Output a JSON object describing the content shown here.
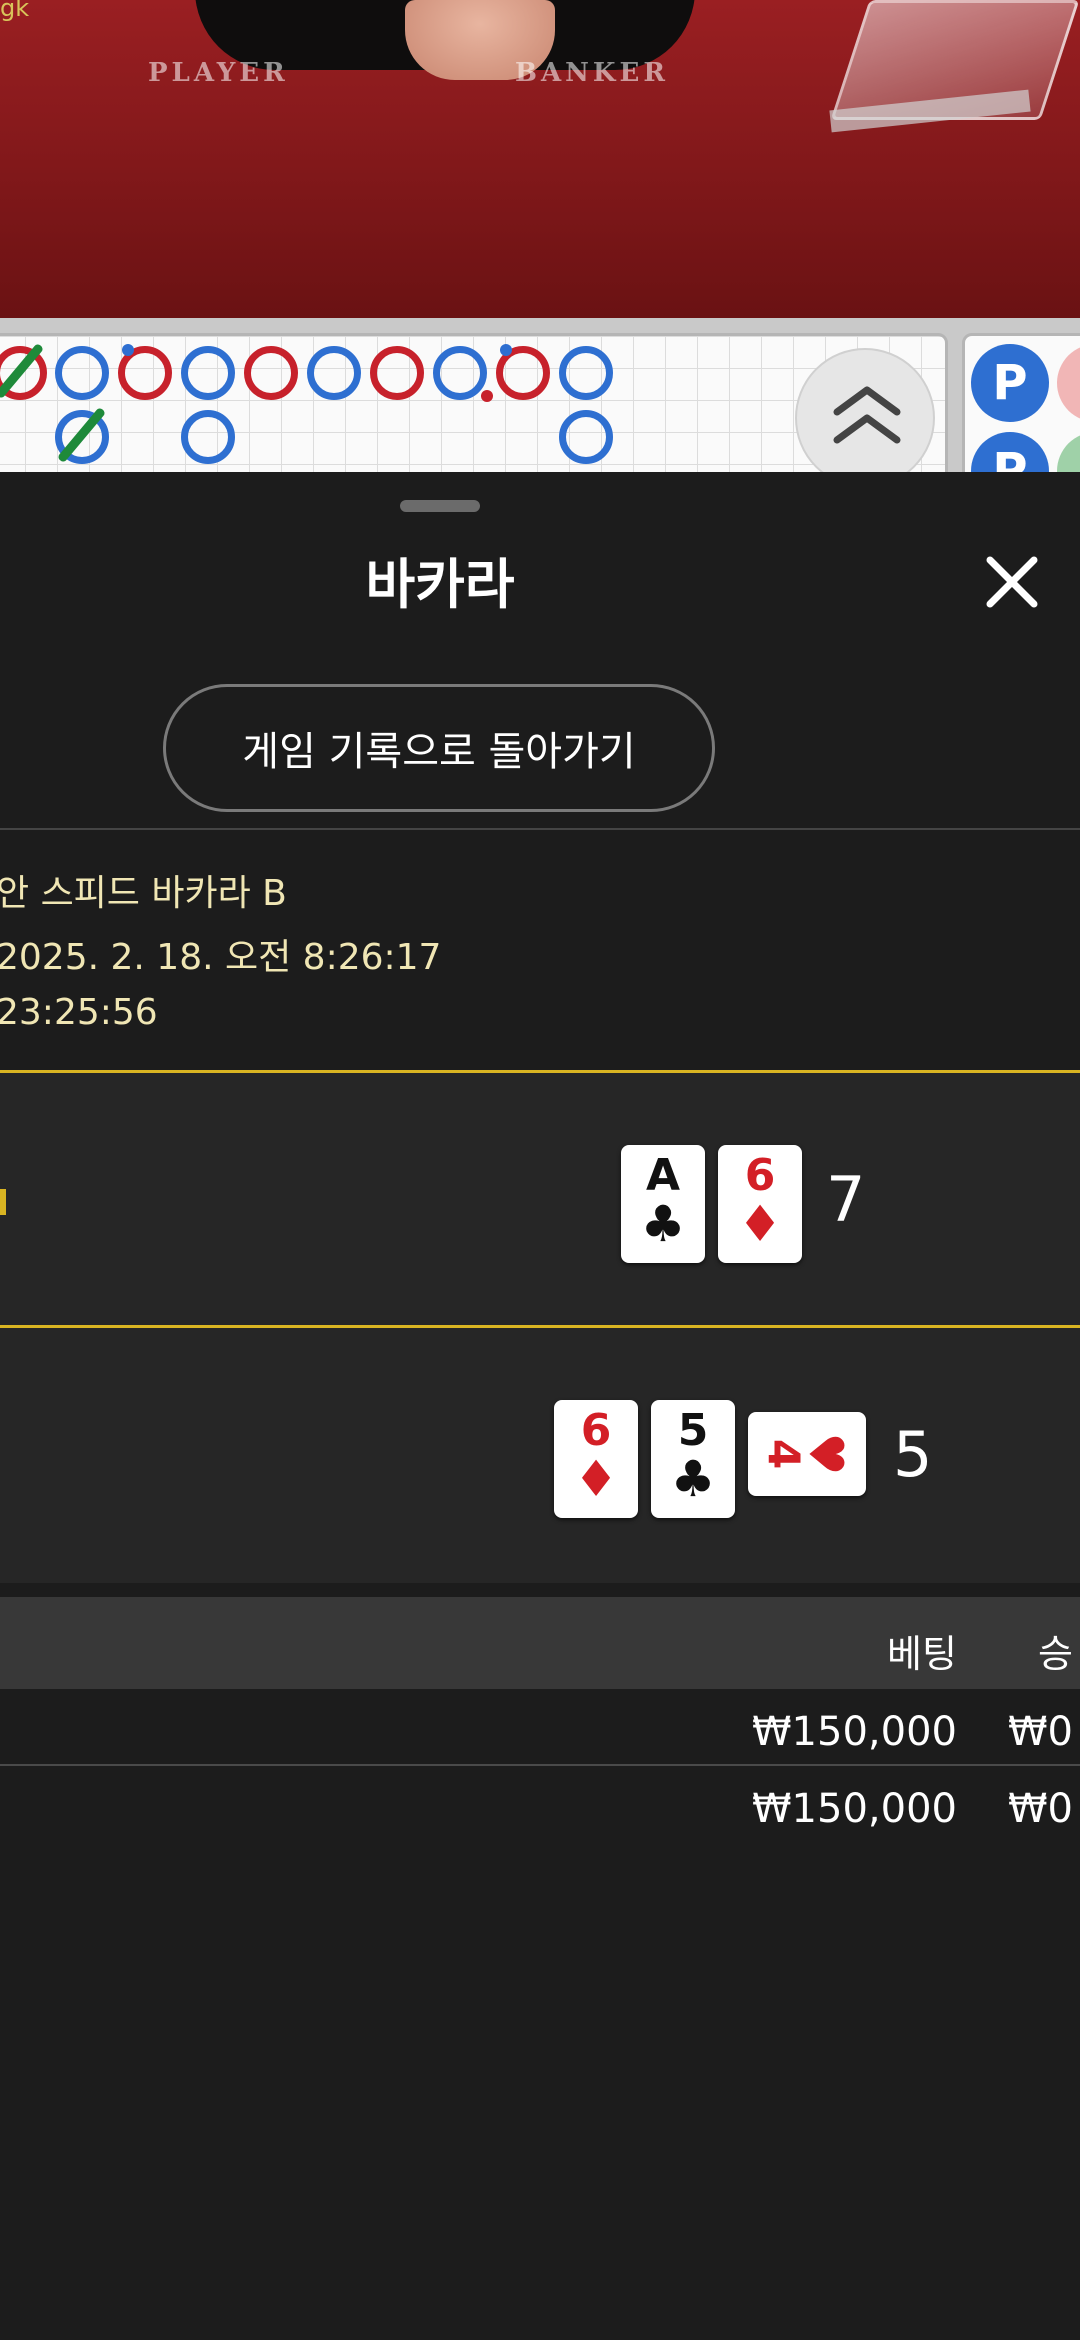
{
  "video": {
    "watermark": "gk",
    "player_label": "PLAYER",
    "banker_label": "BANKER"
  },
  "road": {
    "big_road_letter": "P"
  },
  "sheet": {
    "title": "바카라",
    "back_button": "게임 기록으로 돌아가기",
    "info": {
      "game_name": "안 스피드 바카라 B",
      "datetime": "2025. 2. 18. 오전 8:26:17",
      "round_id": "23:25:56"
    },
    "hands": [
      {
        "cards": [
          {
            "rank": "A",
            "suit": "♣",
            "color": "#111111"
          },
          {
            "rank": "6",
            "suit": "♦",
            "color": "#d31f26"
          }
        ],
        "score": "7"
      },
      {
        "cards": [
          {
            "rank": "6",
            "suit": "♦",
            "color": "#d31f26"
          },
          {
            "rank": "5",
            "suit": "♣",
            "color": "#111111"
          },
          {
            "rank": "4",
            "suit": "♥",
            "color": "#d31f26"
          }
        ],
        "score": "5"
      }
    ],
    "table": {
      "headers": [
        "베팅",
        "승"
      ],
      "rows": [
        {
          "bet": "₩150,000",
          "win": "₩0"
        },
        {
          "bet": "₩150,000",
          "win": "₩0"
        }
      ]
    }
  },
  "colors": {
    "accent": "#d9b422",
    "player_blue": "#2e6fd1",
    "banker_red": "#c7212b",
    "tie_green": "#1e8a3a"
  }
}
